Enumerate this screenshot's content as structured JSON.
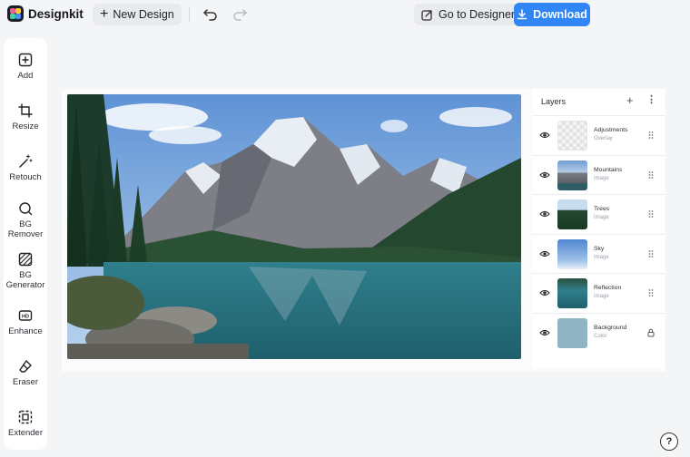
{
  "app": {
    "name": "Designkit"
  },
  "toolbar": {
    "new_design_label": "New Design",
    "go_to_designer_label": "Go to Designer",
    "download_label": "Download"
  },
  "tools": [
    {
      "label": "Add",
      "icon": "add-square-icon"
    },
    {
      "label": "Resize",
      "icon": "crop-icon"
    },
    {
      "label": "Retouch",
      "icon": "magic-wand-icon"
    },
    {
      "label": "BG Remover",
      "icon": "bg-remover-icon"
    },
    {
      "label": "BG Generator",
      "icon": "bg-generator-icon"
    },
    {
      "label": "Enhance",
      "icon": "hd-icon"
    },
    {
      "label": "Eraser",
      "icon": "eraser-icon"
    },
    {
      "label": "Extender",
      "icon": "extender-icon"
    }
  ],
  "layers_panel": {
    "title": "Layers",
    "items": [
      {
        "name": "Adjustments",
        "type": "Overlay",
        "trailing": "drag-handle-icon"
      },
      {
        "name": "Mountains",
        "type": "Image",
        "trailing": "drag-handle-icon"
      },
      {
        "name": "Trees",
        "type": "Image",
        "trailing": "drag-handle-icon"
      },
      {
        "name": "Sky",
        "type": "Image",
        "trailing": "drag-handle-icon"
      },
      {
        "name": "Reflection",
        "type": "Image",
        "trailing": "drag-handle-icon"
      },
      {
        "name": "Background",
        "type": "Color",
        "trailing": "lock-icon"
      }
    ]
  },
  "help": {
    "label": "?"
  },
  "colors": {
    "accent": "#2f86f4",
    "background_layer": "#8fb5c4"
  }
}
